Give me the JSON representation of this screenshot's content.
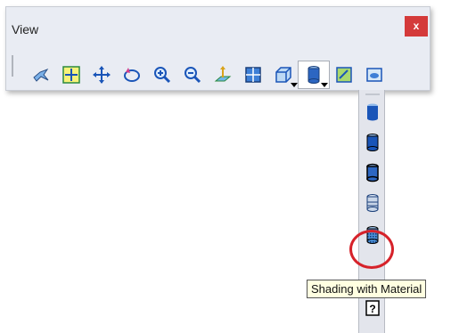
{
  "window": {
    "title": "View",
    "close_label": "x"
  },
  "toolbar": {
    "buttons": [
      {
        "icon": "fly-mode-icon"
      },
      {
        "icon": "fit-all-in-icon"
      },
      {
        "icon": "pan-icon"
      },
      {
        "icon": "rotate-icon"
      },
      {
        "icon": "zoom-in-icon"
      },
      {
        "icon": "zoom-out-icon"
      },
      {
        "icon": "normal-view-icon"
      },
      {
        "icon": "multi-view-icon"
      },
      {
        "icon": "quick-view-icon"
      },
      {
        "icon": "view-mode-icon"
      },
      {
        "icon": "hide-show-icon"
      },
      {
        "icon": "swap-visible-space-icon"
      }
    ]
  },
  "flyout": {
    "items": [
      "shading-icon",
      "shading-with-edges-icon",
      "shading-with-edges-without-smooth-icon",
      "wireframe-icon",
      "shading-with-material-icon",
      "customize-view-icon"
    ]
  },
  "tooltip": {
    "text": "Shading with Material"
  },
  "colors": {
    "highlight": "#d6222a",
    "tooltip_bg": "#ffffe1",
    "icon_blue": "#1a55b8"
  }
}
